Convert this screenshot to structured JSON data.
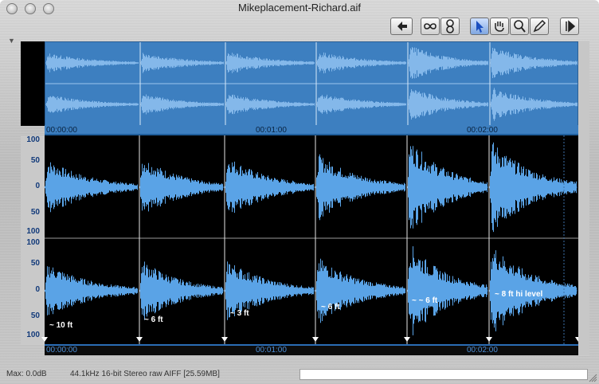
{
  "window": {
    "title": "Mikeplacement-Richard.aif"
  },
  "toolbar": {
    "buttons": [
      {
        "name": "back-icon"
      },
      {
        "name": "loop-icon"
      },
      {
        "name": "hourglass-icon"
      },
      {
        "name": "arrow-icon"
      },
      {
        "name": "hand-icon"
      },
      {
        "name": "zoom-icon"
      },
      {
        "name": "pencil-icon"
      },
      {
        "name": "play-icon"
      }
    ]
  },
  "overview": {
    "time_labels": [
      "00:00:00",
      "00:01:00",
      "00:02:00"
    ]
  },
  "main": {
    "y_ticks_top": [
      "100",
      "50",
      "0",
      "50",
      "100"
    ],
    "y_ticks_bottom": [
      "100",
      "50",
      "0",
      "50",
      "100"
    ],
    "time_labels": [
      "00:00:00",
      "00:01:00",
      "00:02:00"
    ],
    "markers": [
      {
        "label": "~ 10 ft"
      },
      {
        "label": "~ 6 ft"
      },
      {
        "label": "~ 3 ft"
      },
      {
        "label": "~ 6 ft"
      },
      {
        "label": "~ ~ 6 ft"
      },
      {
        "label": "~ 8 ft hi level"
      }
    ]
  },
  "status": {
    "max": "Max: 0.0dB",
    "format": "44.1kHz 16-bit Stereo raw  AIFF [25.59MB]"
  },
  "colors": {
    "waveform": "#5aa3e6",
    "overview_bg": "#3d7fc0",
    "overview_wave": "#84b8ea"
  }
}
